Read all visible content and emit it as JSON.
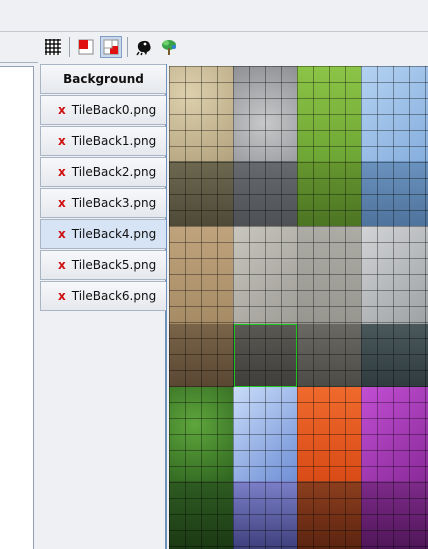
{
  "toolbar": {
    "buttons": [
      {
        "name": "grid-icon",
        "active": false
      },
      {
        "name": "red-layer-icon",
        "active": false
      },
      {
        "name": "layer-select-icon",
        "active": true
      },
      {
        "name": "walker-icon",
        "active": false
      },
      {
        "name": "tree-icon",
        "active": false
      }
    ]
  },
  "tabs": {
    "background_label": "Background",
    "remove_glyph": "x",
    "items": [
      {
        "label": "TileBack0.png",
        "selected": false
      },
      {
        "label": "TileBack1.png",
        "selected": false
      },
      {
        "label": "TileBack2.png",
        "selected": false
      },
      {
        "label": "TileBack3.png",
        "selected": false
      },
      {
        "label": "TileBack4.png",
        "selected": true
      },
      {
        "label": "TileBack5.png",
        "selected": false
      },
      {
        "label": "TileBack6.png",
        "selected": false
      }
    ]
  },
  "tileset": {
    "columns": [
      "sandstone",
      "stone",
      "grass",
      "ice"
    ],
    "palette": {
      "sandstone": "#c9b891",
      "sandstone_dark": "#6d6248",
      "stone": "#9ea0a3",
      "stone_dark": "#575a5e",
      "grass": "#7bb53a",
      "grass_dark": "#54762b",
      "ice": "#8fb6e3",
      "ice_dark": "#5a82ad",
      "tan": "#b59a73",
      "plate": "#b4b3ad",
      "marble": "#b7b9bb",
      "brown": "#6b5740",
      "darkgrey": "#4a4a48",
      "slate": "#3e4a4e",
      "vine": "#3e7b2a",
      "crystal": "#8aa7e2",
      "lava": "#e65a22",
      "amethyst": "#a63bb4"
    },
    "selection_color": "#1ec21e"
  }
}
